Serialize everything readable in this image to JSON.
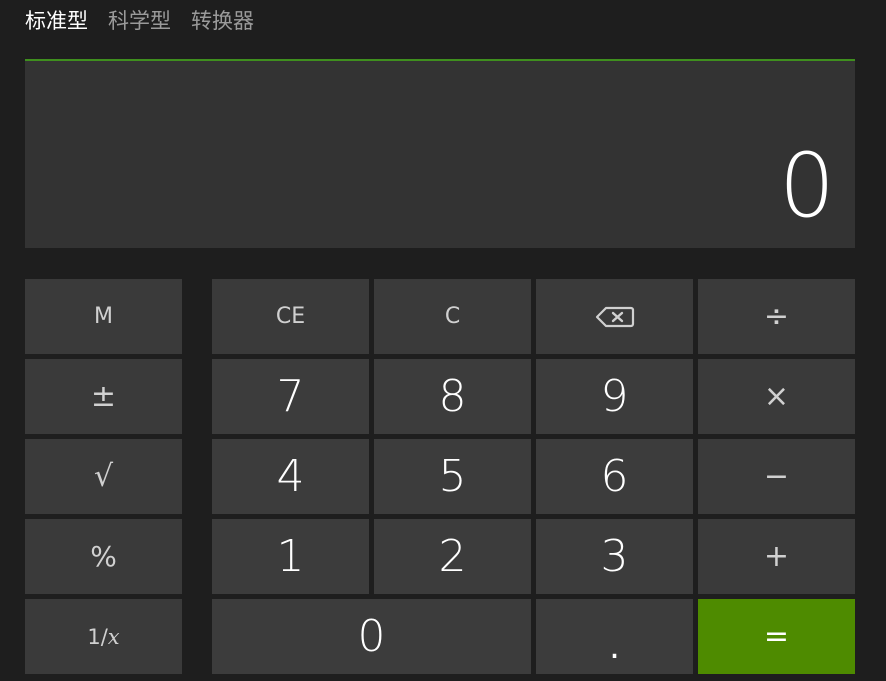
{
  "tabs": [
    {
      "label": "标准型",
      "active": true
    },
    {
      "label": "科学型",
      "active": false
    },
    {
      "label": "转换器",
      "active": false
    }
  ],
  "display": {
    "value": "0"
  },
  "keys": {
    "memory": "M",
    "negate": "±",
    "sqrt": "√",
    "percent": "%",
    "reciprocal_prefix": "1/",
    "reciprocal_var": "x",
    "clear_entry": "CE",
    "clear": "C",
    "backspace_icon": "backspace-icon",
    "divide": "÷",
    "multiply": "×",
    "subtract": "−",
    "add": "+",
    "equals": "=",
    "decimal": ".",
    "d7": "7",
    "d8": "8",
    "d9": "9",
    "d4": "4",
    "d5": "5",
    "d6": "6",
    "d1": "1",
    "d2": "2",
    "d3": "3",
    "d0": "0"
  },
  "colors": {
    "background": "#1e1e1e",
    "display": "#333333",
    "key": "#3c3c3c",
    "accent_equals": "#4e8b00",
    "accent_line": "#3f8f1e"
  }
}
